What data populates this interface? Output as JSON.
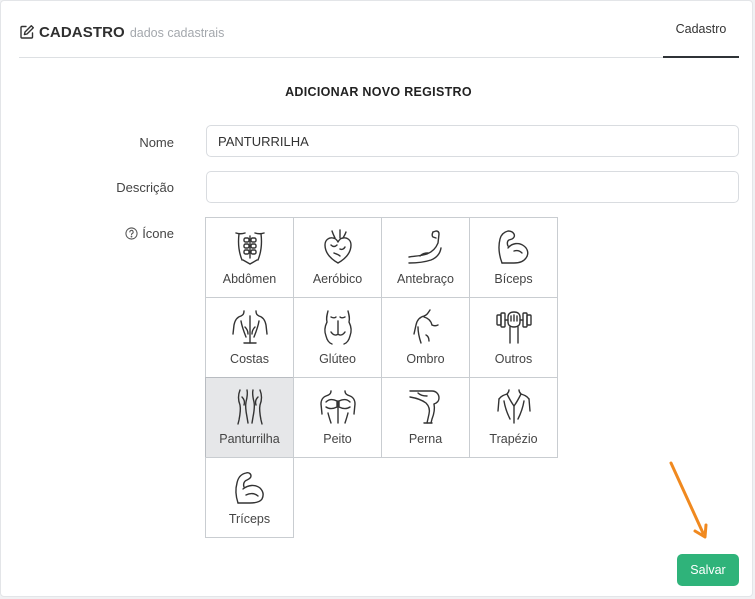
{
  "header": {
    "title": "CADASTRO",
    "subtitle": "dados cadastrais",
    "tab_label": "Cadastro"
  },
  "form": {
    "title": "ADICIONAR NOVO REGISTRO",
    "nome_label": "Nome",
    "nome_value": "PANTURRILHA",
    "descricao_label": "Descrição",
    "descricao_value": "",
    "icone_label": "Ícone",
    "save_label": "Salvar"
  },
  "icons": [
    {
      "label": "Abdômen",
      "icon": "abdomen-icon"
    },
    {
      "label": "Aeróbico",
      "icon": "heart-icon"
    },
    {
      "label": "Antebraço",
      "icon": "forearm-icon"
    },
    {
      "label": "Bíceps",
      "icon": "biceps-icon"
    },
    {
      "label": "Costas",
      "icon": "back-icon"
    },
    {
      "label": "Glúteo",
      "icon": "glute-icon"
    },
    {
      "label": "Ombro",
      "icon": "shoulder-icon"
    },
    {
      "label": "Outros",
      "icon": "dumbbell-fist-icon"
    },
    {
      "label": "Panturrilha",
      "icon": "calf-icon",
      "selected": true
    },
    {
      "label": "Peito",
      "icon": "chest-icon"
    },
    {
      "label": "Perna",
      "icon": "leg-icon"
    },
    {
      "label": "Trapézio",
      "icon": "trapezius-icon"
    },
    {
      "label": "Tríceps",
      "icon": "triceps-icon"
    }
  ],
  "colors": {
    "accent_green": "#2fb37a",
    "annotation_arrow": "#f0891f",
    "selected_tile": "#e6e7e9"
  }
}
